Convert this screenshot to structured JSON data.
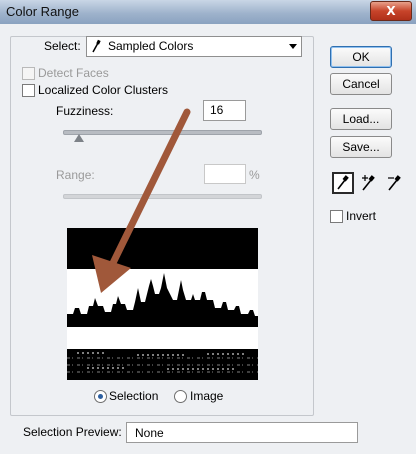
{
  "window": {
    "title": "Color Range",
    "close_label": "X"
  },
  "select": {
    "label": "Select:",
    "value": "Sampled Colors"
  },
  "detect_faces": {
    "label": "Detect Faces",
    "checked": false,
    "enabled": false
  },
  "localized_clusters": {
    "label": "Localized Color Clusters",
    "checked": false
  },
  "fuzziness": {
    "label": "Fuzziness:",
    "value": "16"
  },
  "range": {
    "label": "Range:",
    "value": "",
    "unit": "%"
  },
  "buttons": {
    "ok": "OK",
    "cancel": "Cancel",
    "load": "Load...",
    "save": "Save..."
  },
  "tools": [
    "eyedropper-icon",
    "eyedropper-plus-icon",
    "eyedropper-minus-icon"
  ],
  "invert": {
    "label": "Invert",
    "checked": false
  },
  "view": {
    "options": [
      "Selection",
      "Image"
    ],
    "selected": "Selection"
  },
  "selection_preview": {
    "label": "Selection Preview:",
    "value": "None"
  },
  "colors": {
    "arrow": "#a0583a",
    "titlebar": "#9fb3cc",
    "close": "#c7442a",
    "ok_border": "#2f6fb0"
  }
}
